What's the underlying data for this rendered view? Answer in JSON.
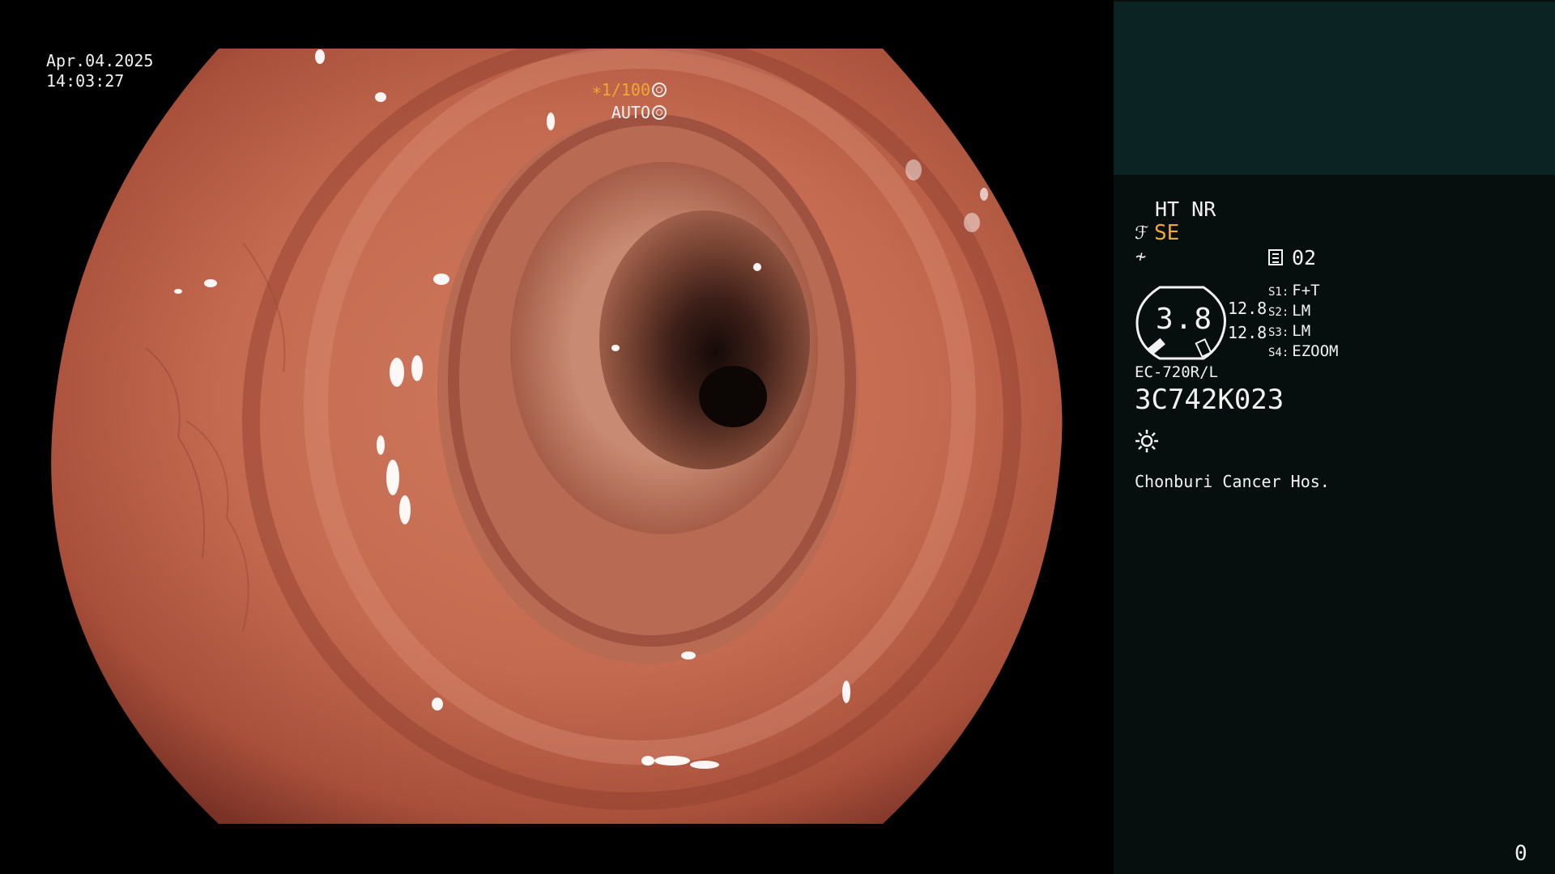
{
  "overlay": {
    "date": "Apr.04.2025",
    "time": "14:03:27",
    "shutter": "∗1/100",
    "iris": "AUTO"
  },
  "panel": {
    "mode_ht_nr": "HT NR",
    "enhance_icon": "enhance-icon",
    "enhance_mode": "SE",
    "color_icon": "color-setting-icon",
    "channel_icon": "channel-memo-icon",
    "channel": "02",
    "gauge_value": "3.8",
    "value_1": "12.8",
    "value_2": "12.8",
    "switches": [
      {
        "key": "S1:",
        "value": "F+T"
      },
      {
        "key": "S2:",
        "value": "LM"
      },
      {
        "key": "S3:",
        "value": "LM"
      },
      {
        "key": "S4:",
        "value": "EZOOM"
      }
    ],
    "scope_model": "EC-720R/L",
    "scope_serial": "3C742K023",
    "light_icon": "light-source-icon",
    "hospital": "Chonburi Cancer Hos.",
    "counter": "0"
  },
  "colors": {
    "accent_orange": "#f0a830",
    "panel_bg": "#060f0e",
    "panel_top_bg": "#0b2322",
    "tissue": "#b8573f"
  }
}
